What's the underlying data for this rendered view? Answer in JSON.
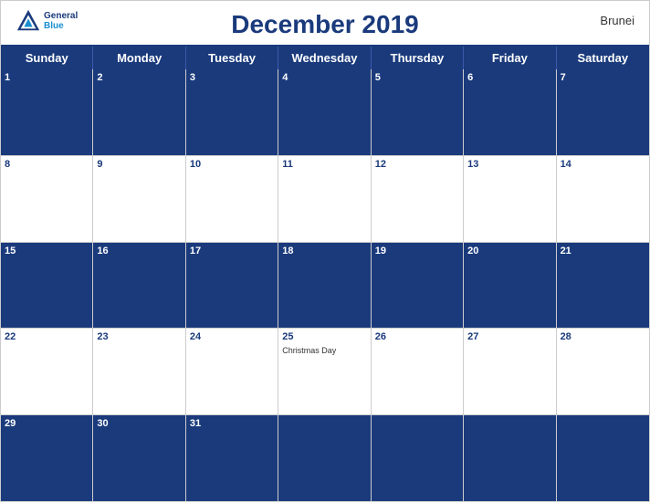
{
  "header": {
    "title": "December 2019",
    "country": "Brunei",
    "logo_general": "General",
    "logo_blue": "Blue"
  },
  "days_of_week": [
    "Sunday",
    "Monday",
    "Tuesday",
    "Wednesday",
    "Thursday",
    "Friday",
    "Saturday"
  ],
  "weeks": [
    [
      {
        "num": "1",
        "blue": true,
        "events": []
      },
      {
        "num": "2",
        "blue": true,
        "events": []
      },
      {
        "num": "3",
        "blue": true,
        "events": []
      },
      {
        "num": "4",
        "blue": true,
        "events": []
      },
      {
        "num": "5",
        "blue": true,
        "events": []
      },
      {
        "num": "6",
        "blue": true,
        "events": []
      },
      {
        "num": "7",
        "blue": true,
        "events": []
      }
    ],
    [
      {
        "num": "8",
        "blue": false,
        "events": []
      },
      {
        "num": "9",
        "blue": false,
        "events": []
      },
      {
        "num": "10",
        "blue": false,
        "events": []
      },
      {
        "num": "11",
        "blue": false,
        "events": []
      },
      {
        "num": "12",
        "blue": false,
        "events": []
      },
      {
        "num": "13",
        "blue": false,
        "events": []
      },
      {
        "num": "14",
        "blue": false,
        "events": []
      }
    ],
    [
      {
        "num": "15",
        "blue": true,
        "events": []
      },
      {
        "num": "16",
        "blue": true,
        "events": []
      },
      {
        "num": "17",
        "blue": true,
        "events": []
      },
      {
        "num": "18",
        "blue": true,
        "events": []
      },
      {
        "num": "19",
        "blue": true,
        "events": []
      },
      {
        "num": "20",
        "blue": true,
        "events": []
      },
      {
        "num": "21",
        "blue": true,
        "events": []
      }
    ],
    [
      {
        "num": "22",
        "blue": false,
        "events": []
      },
      {
        "num": "23",
        "blue": false,
        "events": []
      },
      {
        "num": "24",
        "blue": false,
        "events": []
      },
      {
        "num": "25",
        "blue": false,
        "events": [
          "Christmas Day"
        ]
      },
      {
        "num": "26",
        "blue": false,
        "events": []
      },
      {
        "num": "27",
        "blue": false,
        "events": []
      },
      {
        "num": "28",
        "blue": false,
        "events": []
      }
    ],
    [
      {
        "num": "29",
        "blue": true,
        "events": []
      },
      {
        "num": "30",
        "blue": true,
        "events": []
      },
      {
        "num": "31",
        "blue": true,
        "events": []
      },
      {
        "num": "",
        "blue": true,
        "events": []
      },
      {
        "num": "",
        "blue": true,
        "events": []
      },
      {
        "num": "",
        "blue": true,
        "events": []
      },
      {
        "num": "",
        "blue": true,
        "events": []
      }
    ]
  ],
  "colors": {
    "header_blue": "#1a3a7c",
    "white": "#ffffff",
    "border": "#cccccc"
  }
}
